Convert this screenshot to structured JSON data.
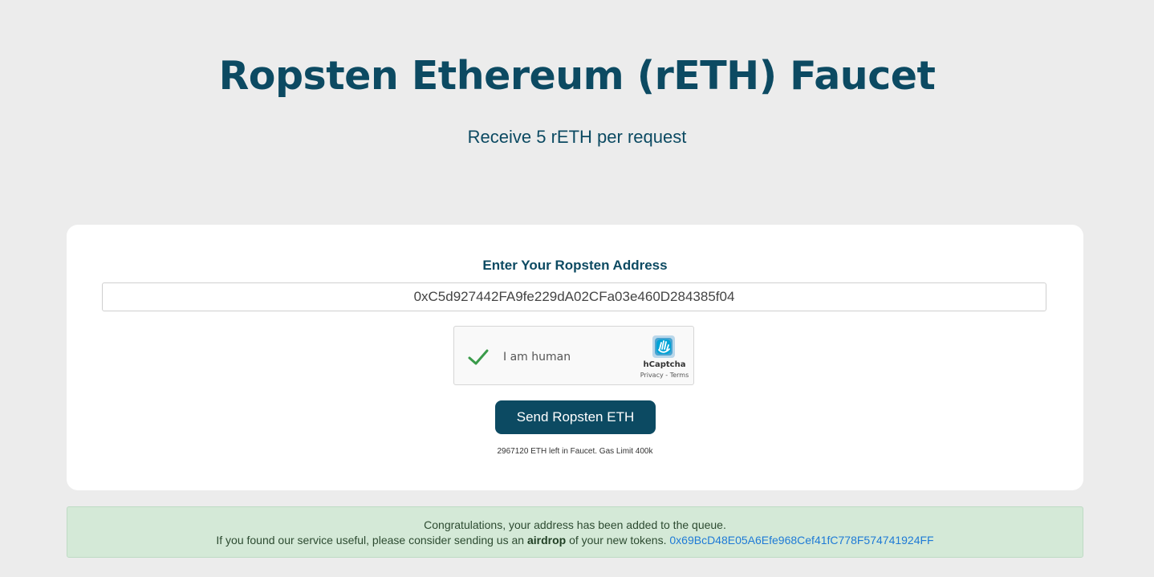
{
  "header": {
    "title": "Ropsten Ethereum (rETH) Faucet",
    "subtitle": "Receive 5 rETH per request"
  },
  "form": {
    "label": "Enter Your Ropsten Address",
    "address_value": "0xC5d927442FA9fe229dA02CFa03e460D284385f04"
  },
  "captcha": {
    "label": "I am human",
    "brand": "hCaptcha",
    "links": "Privacy - Terms",
    "checked": true,
    "check_color": "#3a9b4a",
    "icon": "hcaptcha-logo-icon"
  },
  "send_button": {
    "label": "Send Ropsten ETH"
  },
  "faucet_info": "2967120 ETH left in Faucet. Gas Limit 400k",
  "alert": {
    "line1": "Congratulations, your address has been added to the queue.",
    "line2_before": "If you found our service useful, please consider sending us an",
    "airdrop": "airdrop",
    "line2_after": "of your new tokens.",
    "donation_address": "0x69BcD48E05A6Efe968Cef41fC778F574741924FF"
  },
  "colors": {
    "primary": "#0c4a62",
    "background": "#ececec",
    "success_bg": "#d4e9d7",
    "link": "#1e7ad6"
  }
}
